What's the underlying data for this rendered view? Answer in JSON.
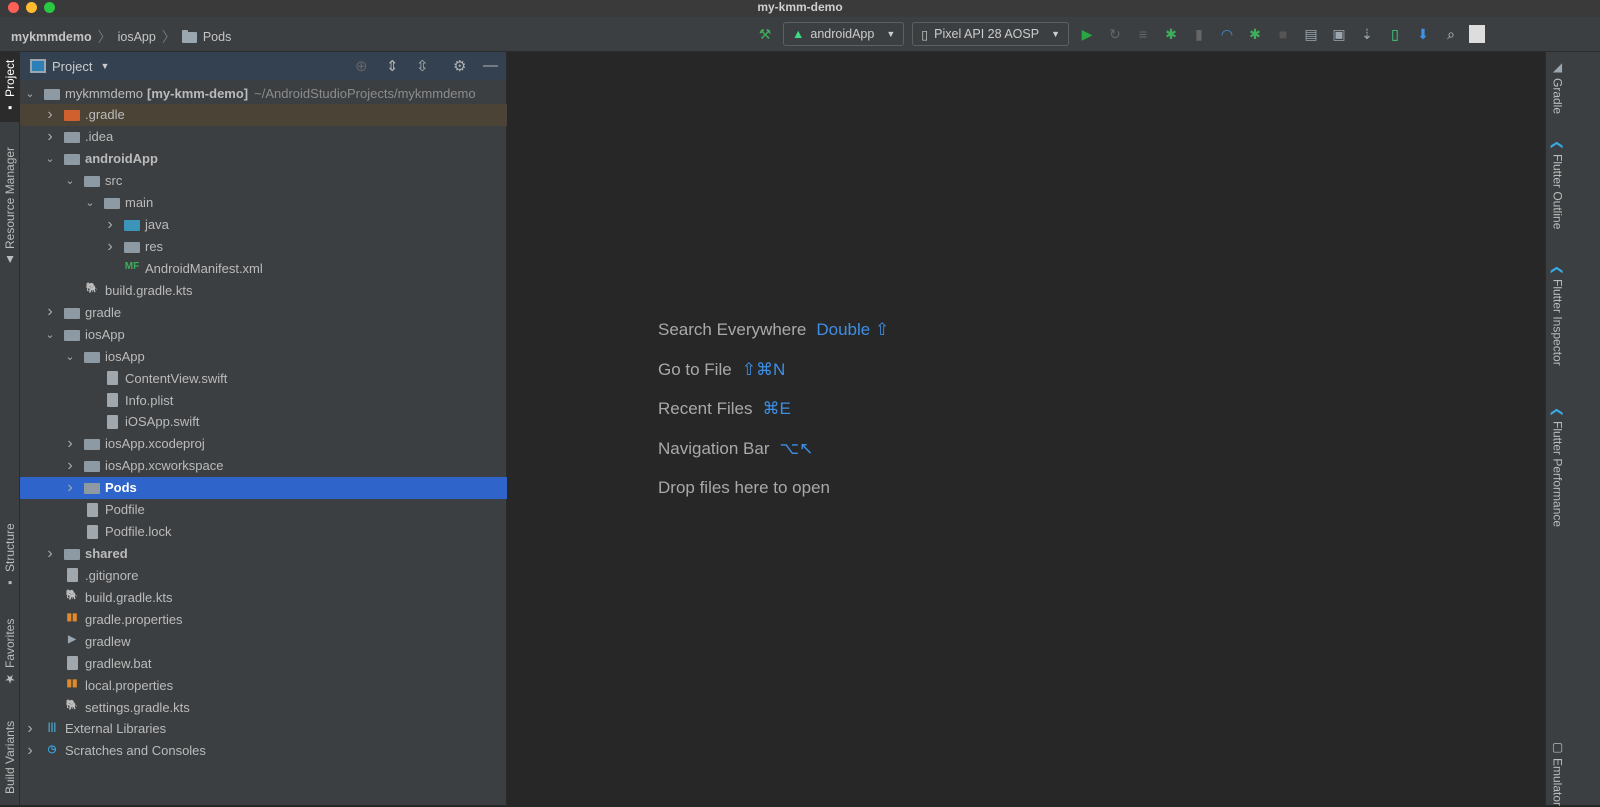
{
  "window": {
    "title": "my-kmm-demo"
  },
  "breadcrumb": [
    "mykmmdemo",
    "iosApp",
    "Pods"
  ],
  "toolbar": {
    "run_config": "androidApp",
    "device": "Pixel API 28 AOSP"
  },
  "left_tabs": [
    "Project",
    "Resource Manager",
    "Structure",
    "Favorites",
    "Build Variants"
  ],
  "right_tabs": [
    "Gradle",
    "Flutter Outline",
    "Flutter Inspector",
    "Flutter Performance",
    "Emulator"
  ],
  "project_panel": {
    "title": "Project"
  },
  "tree": [
    {
      "level": 0,
      "chev": "open",
      "icon": "module",
      "name": "mykmmdemo",
      "bold_suffix": "[my-kmm-demo]",
      "path": "~/AndroidStudioProjects/mykmmdemo"
    },
    {
      "level": 1,
      "chev": "closed",
      "icon": "folder-orange",
      "name": ".gradle",
      "hl": true
    },
    {
      "level": 1,
      "chev": "closed",
      "icon": "folder",
      "name": ".idea"
    },
    {
      "level": 1,
      "chev": "open",
      "icon": "folder",
      "name": "androidApp",
      "bold": true
    },
    {
      "level": 2,
      "chev": "open",
      "icon": "folder",
      "name": "src"
    },
    {
      "level": 3,
      "chev": "open",
      "icon": "folder",
      "name": "main"
    },
    {
      "level": 4,
      "chev": "closed",
      "icon": "folder-blue",
      "name": "java"
    },
    {
      "level": 4,
      "chev": "closed",
      "icon": "folder",
      "name": "res"
    },
    {
      "level": 4,
      "chev": "none",
      "icon": "manifest",
      "name": "AndroidManifest.xml"
    },
    {
      "level": 2,
      "chev": "none",
      "icon": "gradle",
      "name": "build.gradle.kts"
    },
    {
      "level": 1,
      "chev": "closed",
      "icon": "folder",
      "name": "gradle"
    },
    {
      "level": 1,
      "chev": "open",
      "icon": "folder",
      "name": "iosApp"
    },
    {
      "level": 2,
      "chev": "open",
      "icon": "folder",
      "name": "iosApp"
    },
    {
      "level": 3,
      "chev": "none",
      "icon": "file",
      "name": "ContentView.swift"
    },
    {
      "level": 3,
      "chev": "none",
      "icon": "file",
      "name": "Info.plist"
    },
    {
      "level": 3,
      "chev": "none",
      "icon": "file",
      "name": "iOSApp.swift"
    },
    {
      "level": 2,
      "chev": "closed",
      "icon": "folder",
      "name": "iosApp.xcodeproj"
    },
    {
      "level": 2,
      "chev": "closed",
      "icon": "folder",
      "name": "iosApp.xcworkspace"
    },
    {
      "level": 2,
      "chev": "closed",
      "icon": "folder",
      "name": "Pods",
      "bold": true,
      "selected": true
    },
    {
      "level": 2,
      "chev": "none",
      "icon": "file",
      "name": "Podfile"
    },
    {
      "level": 2,
      "chev": "none",
      "icon": "file",
      "name": "Podfile.lock"
    },
    {
      "level": 1,
      "chev": "closed",
      "icon": "folder",
      "name": "shared",
      "bold": true
    },
    {
      "level": 1,
      "chev": "none",
      "icon": "file",
      "name": ".gitignore"
    },
    {
      "level": 1,
      "chev": "none",
      "icon": "gradle",
      "name": "build.gradle.kts"
    },
    {
      "level": 1,
      "chev": "none",
      "icon": "properties",
      "name": "gradle.properties"
    },
    {
      "level": 1,
      "chev": "none",
      "icon": "terminal",
      "name": "gradlew"
    },
    {
      "level": 1,
      "chev": "none",
      "icon": "file",
      "name": "gradlew.bat"
    },
    {
      "level": 1,
      "chev": "none",
      "icon": "properties",
      "name": "local.properties"
    },
    {
      "level": 1,
      "chev": "none",
      "icon": "gradle",
      "name": "settings.gradle.kts"
    },
    {
      "level": 0,
      "chev": "closed",
      "icon": "libraries",
      "name": "External Libraries"
    },
    {
      "level": 0,
      "chev": "closed",
      "icon": "scratches",
      "name": "Scratches and Consoles"
    }
  ],
  "editor_hints": [
    {
      "label": "Search Everywhere",
      "shortcut": "Double ⇧"
    },
    {
      "label": "Go to File",
      "shortcut": "⇧⌘N"
    },
    {
      "label": "Recent Files",
      "shortcut": "⌘E"
    },
    {
      "label": "Navigation Bar",
      "shortcut": "⌥↖"
    },
    {
      "label": "Drop files here to open",
      "shortcut": ""
    }
  ],
  "colors": {
    "selection": "#2f65ca",
    "accent": "#3d8fe6",
    "run": "#28a745"
  }
}
